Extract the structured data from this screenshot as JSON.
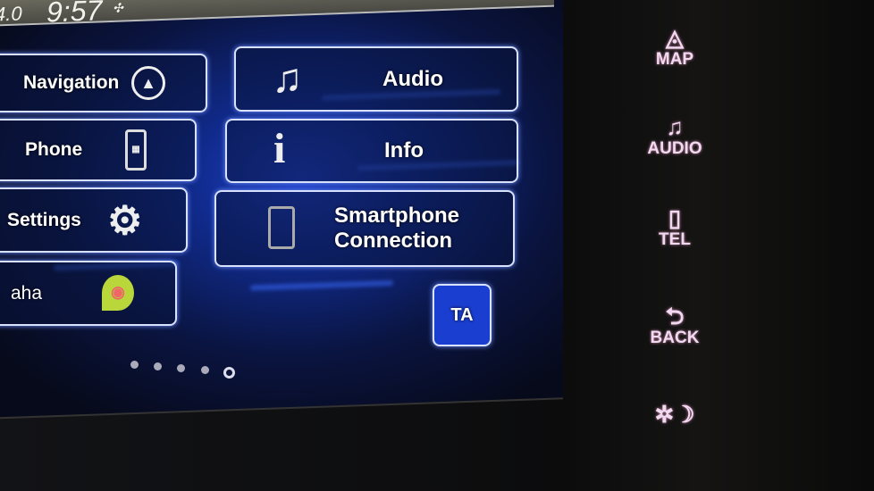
{
  "status_bar": {
    "temperature": "4.0",
    "time": "9:57",
    "icon": "gps-signal-icon"
  },
  "menu": {
    "left": [
      {
        "label": "Navigation",
        "icon": "compass-icon"
      },
      {
        "label": "Phone",
        "icon": "mobile-phone-icon"
      },
      {
        "label": "Settings",
        "icon": "gear-icon"
      },
      {
        "label": "aha",
        "icon": "aha-logo-icon"
      }
    ],
    "right": [
      {
        "label": "Audio",
        "icon": "music-note-icon"
      },
      {
        "label": "Info",
        "icon": "info-icon"
      },
      {
        "label": "Smartphone\nConnection",
        "label_line1": "Smartphone",
        "label_line2": "Connection",
        "icon": "smartphone-icon"
      }
    ],
    "ta_label": "TA"
  },
  "pagination": {
    "pages": 5,
    "current": 5
  },
  "hard_keys": [
    {
      "label": "MAP",
      "icon": "map-icon"
    },
    {
      "label": "AUDIO",
      "icon": "music-note-icon"
    },
    {
      "label": "TEL",
      "icon": "phone-icon"
    },
    {
      "label": "BACK",
      "icon": "back-arrow-icon"
    },
    {
      "label": "",
      "icon": "day-night-icon"
    }
  ],
  "colors": {
    "screen_blue": "#1d3fc8",
    "button_border": "#d8e2ff",
    "hard_key_glow": "#f1d9f2"
  }
}
